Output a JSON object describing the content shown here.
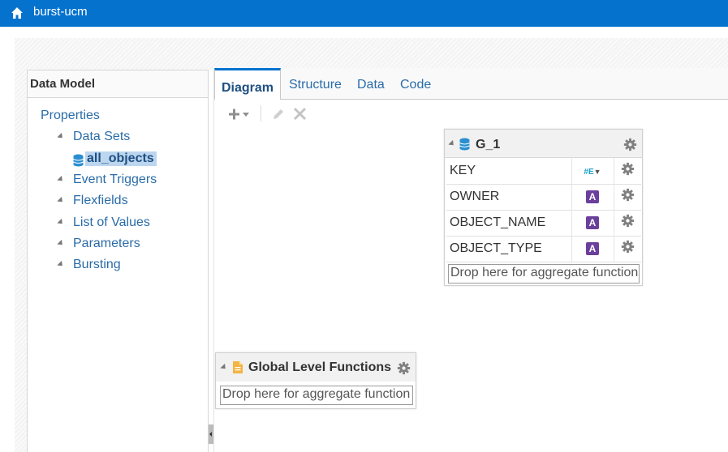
{
  "header": {
    "title": "burst-ucm",
    "home_icon": "home-icon"
  },
  "left_panel": {
    "title": "Data Model",
    "items": [
      {
        "label": "Properties"
      },
      {
        "label": "Data Sets"
      },
      {
        "label": "all_objects"
      },
      {
        "label": "Event Triggers"
      },
      {
        "label": "Flexfields"
      },
      {
        "label": "List of Values"
      },
      {
        "label": "Parameters"
      },
      {
        "label": "Bursting"
      }
    ]
  },
  "tabs": [
    {
      "label": "Diagram"
    },
    {
      "label": "Structure"
    },
    {
      "label": "Data"
    },
    {
      "label": "Code"
    }
  ],
  "group": {
    "title": "G_1",
    "rows": [
      {
        "name": "KEY",
        "type_icon": "number-type-icon"
      },
      {
        "name": "OWNER",
        "type_icon": "string-type-icon",
        "badge": "A"
      },
      {
        "name": "OBJECT_NAME",
        "type_icon": "string-type-icon",
        "badge": "A"
      },
      {
        "name": "OBJECT_TYPE",
        "type_icon": "string-type-icon",
        "badge": "A"
      }
    ],
    "drop_text": "Drop here for aggregate function"
  },
  "global": {
    "title": "Global Level Functions",
    "drop_text": "Drop here for aggregate function"
  },
  "colors": {
    "brand": "#0572ce",
    "link": "#2a6ca8",
    "badge": "#6b3f9c"
  }
}
